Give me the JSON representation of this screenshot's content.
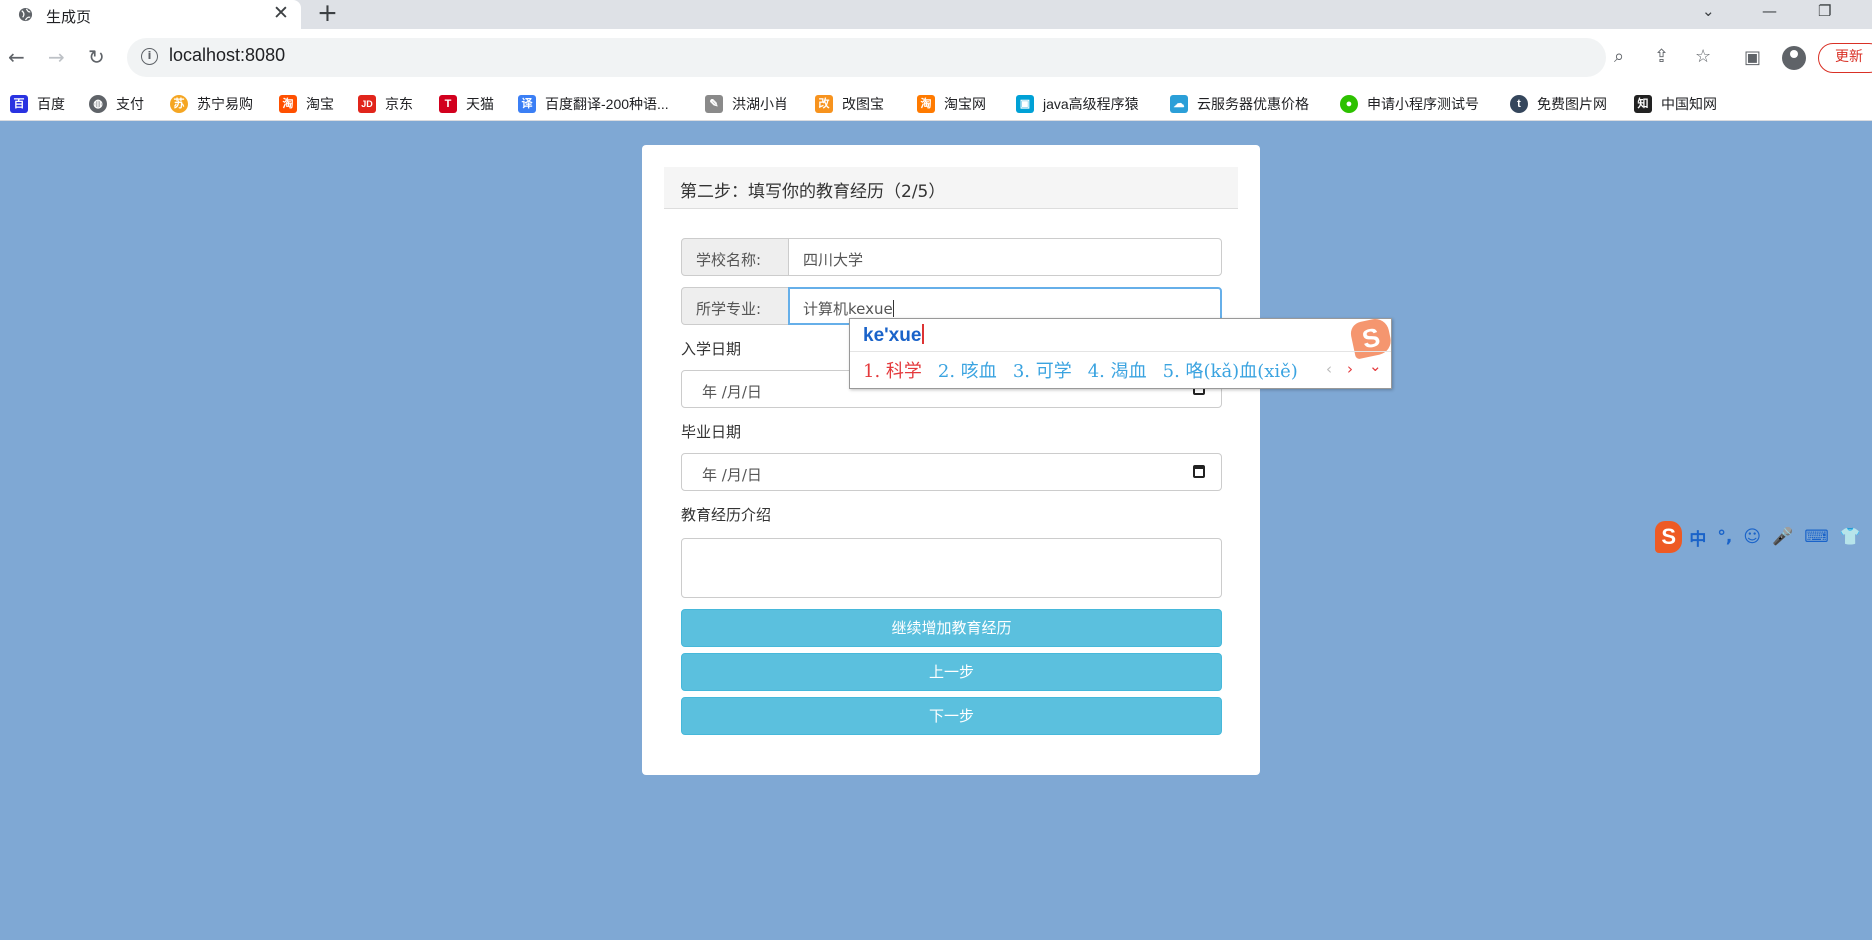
{
  "browser": {
    "tab_title": "生成页",
    "tab_close": "✕",
    "new_tab": "+",
    "url": "localhost:8080",
    "update_label": "更新",
    "bookmarks": [
      {
        "label": "百度",
        "icon": "baidu-icon",
        "color": "#2932e1",
        "glyph": "百"
      },
      {
        "label": "支付",
        "icon": "globe-icon",
        "color": "#5f6368",
        "glyph": "◍"
      },
      {
        "label": "苏宁易购",
        "icon": "suning-icon",
        "color": "#f5a623",
        "glyph": "苏"
      },
      {
        "label": "淘宝",
        "icon": "taobao-icon",
        "color": "#ff5000",
        "glyph": "淘"
      },
      {
        "label": "京东",
        "icon": "jd-icon",
        "color": "#e1251b",
        "glyph": "JD"
      },
      {
        "label": "天猫",
        "icon": "tmall-icon",
        "color": "#d2001e",
        "glyph": "T"
      },
      {
        "label": "百度翻译-200种语...",
        "icon": "translate-icon",
        "color": "#3b7ff5",
        "glyph": "译"
      },
      {
        "label": "洪湖小肖",
        "icon": "feather-icon",
        "color": "#8a8a8a",
        "glyph": "✎"
      },
      {
        "label": "改图宝",
        "icon": "gaitubao-icon",
        "color": "#f7931e",
        "glyph": "改"
      },
      {
        "label": "淘宝网",
        "icon": "taobao-icon",
        "color": "#ff7a00",
        "glyph": "淘"
      },
      {
        "label": "java高级程序猿",
        "icon": "bilibili-icon",
        "color": "#00a1d6",
        "glyph": "▣"
      },
      {
        "label": "云服务器优惠价格",
        "icon": "cloud-icon",
        "color": "#2b9fd8",
        "glyph": "☁"
      },
      {
        "label": "申请小程序测试号",
        "icon": "wechat-icon",
        "color": "#2dc100",
        "glyph": "●"
      },
      {
        "label": "免费图片网",
        "icon": "tumblr-icon",
        "color": "#35465c",
        "glyph": "t"
      },
      {
        "label": "中国知网",
        "icon": "cnki-icon",
        "color": "#222222",
        "glyph": "知"
      }
    ]
  },
  "form": {
    "step_title": "第二步：填写你的教育经历（2/5）",
    "school_label": "学校名称:",
    "school_value": "四川大学",
    "major_label": "所学专业:",
    "major_value": "计算机kexue",
    "start_label": "入学日期",
    "start_placeholder": "年 /月/日",
    "end_label": "毕业日期",
    "end_placeholder": "年 /月/日",
    "intro_label": "教育经历介绍",
    "add_button": "继续增加教育经历",
    "prev_button": "上一步",
    "next_button": "下一步"
  },
  "ime": {
    "pinyin": "ke'xue",
    "candidates": [
      "1. 科学",
      "2. 咳血",
      "3. 可学",
      "4. 渴血",
      "5. 咯(kǎ)血(xiě)"
    ],
    "prev": "‹",
    "next": "›",
    "expand": "⌄",
    "logo": "S",
    "status_items": [
      "中",
      "°,",
      "☺",
      "🎤",
      "⌨",
      "👕"
    ]
  }
}
